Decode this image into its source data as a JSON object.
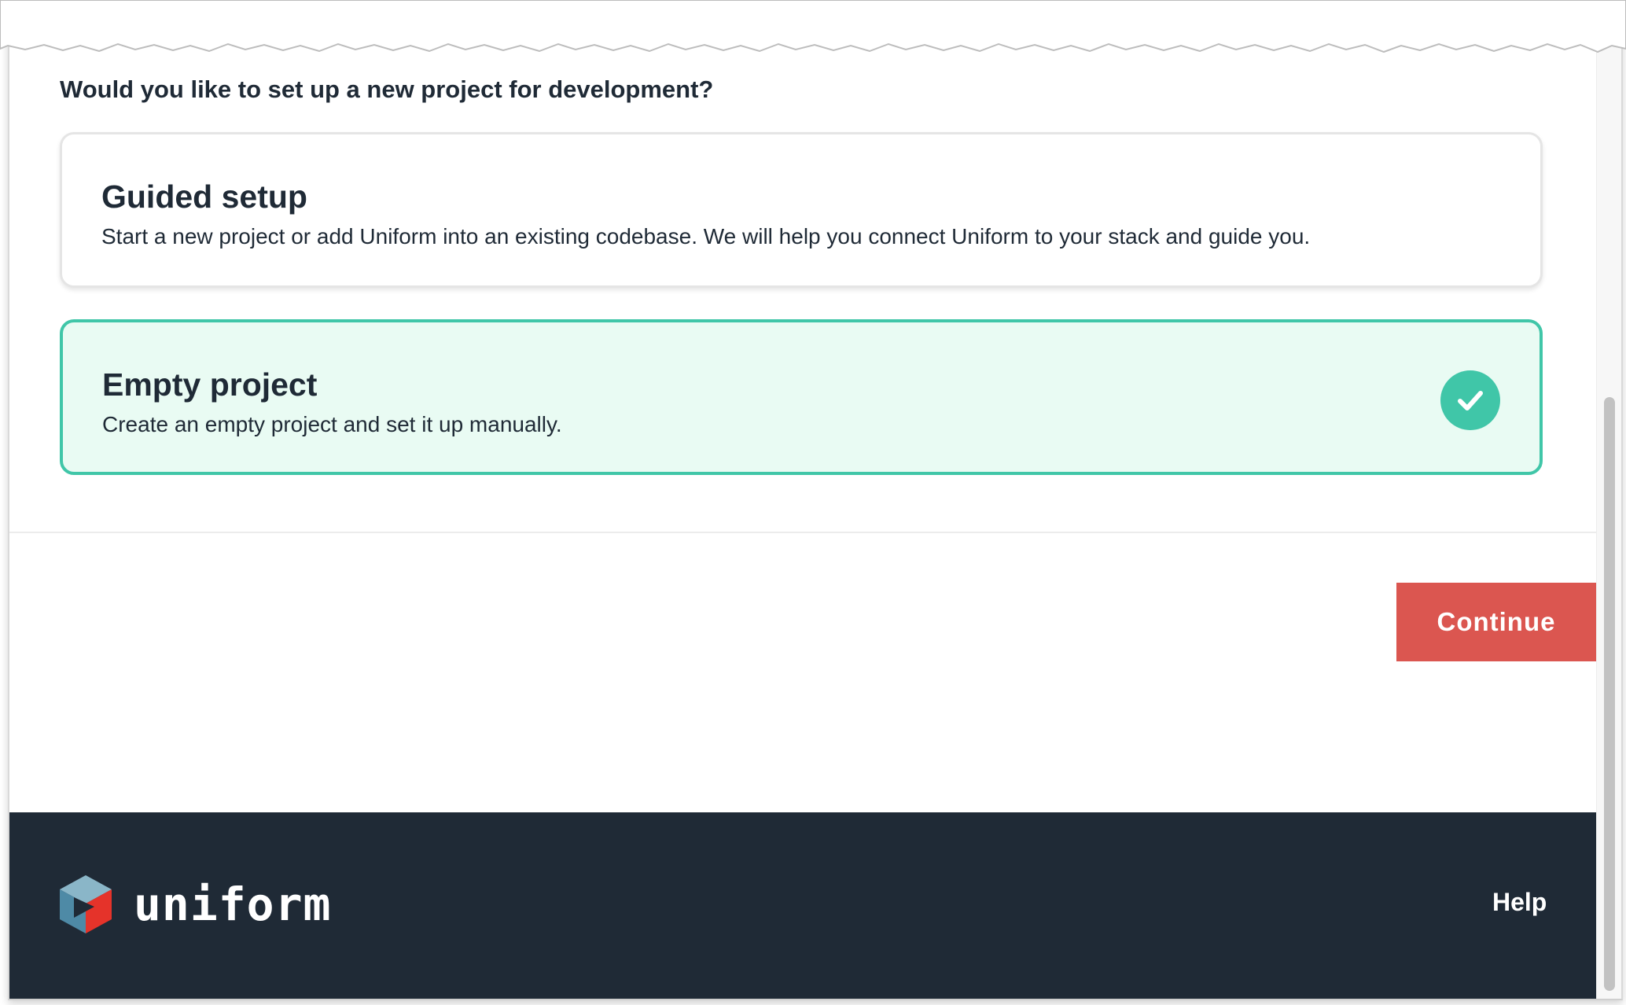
{
  "question": "Would you like to set up a new project for development?",
  "options": [
    {
      "title": "Guided setup",
      "description": "Start a new project or add Uniform into an existing codebase. We will help you connect Uniform to your stack and guide you.",
      "selected": false
    },
    {
      "title": "Empty project",
      "description": "Create an empty project and set it up manually.",
      "selected": true
    }
  ],
  "continue_label": "Continue",
  "footer": {
    "brand": "uniform",
    "help_label": "Help"
  },
  "icons": {
    "selected": "check-circle-icon",
    "logo": "uniform-logo-icon"
  },
  "colors": {
    "text": "#1f2a36",
    "accent_teal": "#40c6a8",
    "selected_bg": "#e9fbf3",
    "continue_bg": "#db5650",
    "footer_bg": "#1f2a36"
  }
}
